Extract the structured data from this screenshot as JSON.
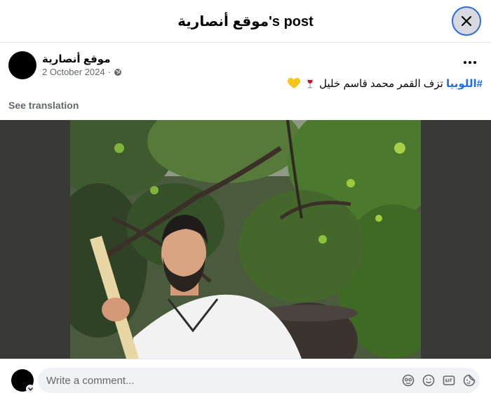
{
  "dialog": {
    "title": "موقع أنصارية's post"
  },
  "post": {
    "author": "موقع أنصارية",
    "date": "2 October 2024",
    "date_separator": "·",
    "hashtag": "#اللوبيا",
    "text": " تزف القمر محمد قاسم خليل",
    "emojis": [
      "wine-glass-icon",
      "yellow-heart-icon"
    ],
    "see_translation": "See translation"
  },
  "comment": {
    "placeholder": "Write a comment..."
  },
  "colors": {
    "hashtag": "#216fdb",
    "close_ring": "#2d6cdf",
    "media_bg": "#393a35"
  }
}
